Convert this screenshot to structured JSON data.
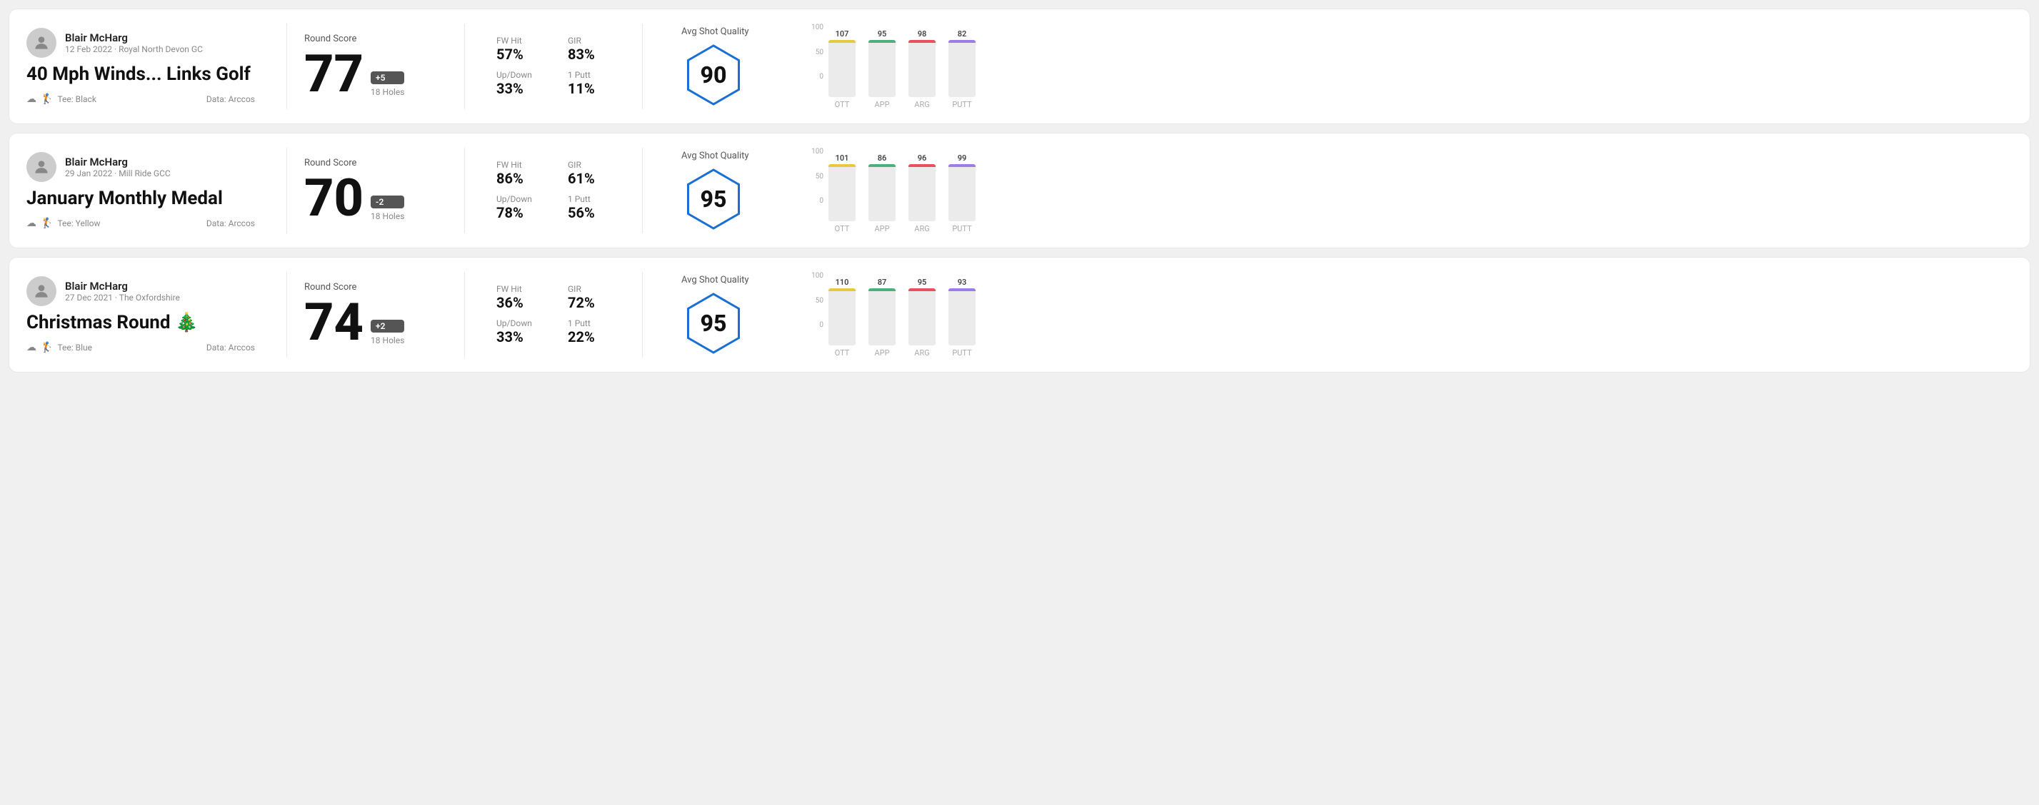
{
  "cards": [
    {
      "id": "card-1",
      "user": {
        "name": "Blair McHarg",
        "date": "12 Feb 2022 · Royal North Devon GC"
      },
      "title": "40 Mph Winds... Links Golf",
      "title_emoji": "🏌️",
      "tee": "Black",
      "data_source": "Data: Arccos",
      "score": {
        "label": "Round Score",
        "number": "77",
        "badge": "+5",
        "holes": "18 Holes"
      },
      "stats": {
        "fw_hit_label": "FW Hit",
        "fw_hit_value": "57%",
        "gir_label": "GIR",
        "gir_value": "83%",
        "updown_label": "Up/Down",
        "updown_value": "33%",
        "oneputt_label": "1 Putt",
        "oneputt_value": "11%"
      },
      "quality": {
        "label": "Avg Shot Quality",
        "value": "90"
      },
      "chart": {
        "bars": [
          {
            "label": "OTT",
            "value": 107,
            "color": "#e8c840",
            "height_pct": 75
          },
          {
            "label": "APP",
            "value": 95,
            "color": "#4caf7d",
            "height_pct": 65
          },
          {
            "label": "ARG",
            "value": 98,
            "color": "#e85060",
            "height_pct": 68
          },
          {
            "label": "PUTT",
            "value": 82,
            "color": "#9c7de8",
            "height_pct": 55
          }
        ],
        "y_labels": [
          "100",
          "50",
          "0"
        ]
      }
    },
    {
      "id": "card-2",
      "user": {
        "name": "Blair McHarg",
        "date": "29 Jan 2022 · Mill Ride GCC"
      },
      "title": "January Monthly Medal",
      "title_emoji": "",
      "tee": "Yellow",
      "data_source": "Data: Arccos",
      "score": {
        "label": "Round Score",
        "number": "70",
        "badge": "-2",
        "holes": "18 Holes"
      },
      "stats": {
        "fw_hit_label": "FW Hit",
        "fw_hit_value": "86%",
        "gir_label": "GIR",
        "gir_value": "61%",
        "updown_label": "Up/Down",
        "updown_value": "78%",
        "oneputt_label": "1 Putt",
        "oneputt_value": "56%"
      },
      "quality": {
        "label": "Avg Shot Quality",
        "value": "95"
      },
      "chart": {
        "bars": [
          {
            "label": "OTT",
            "value": 101,
            "color": "#e8c840",
            "height_pct": 72
          },
          {
            "label": "APP",
            "value": 86,
            "color": "#4caf7d",
            "height_pct": 60
          },
          {
            "label": "ARG",
            "value": 96,
            "color": "#e85060",
            "height_pct": 67
          },
          {
            "label": "PUTT",
            "value": 99,
            "color": "#9c7de8",
            "height_pct": 70
          }
        ],
        "y_labels": [
          "100",
          "50",
          "0"
        ]
      }
    },
    {
      "id": "card-3",
      "user": {
        "name": "Blair McHarg",
        "date": "27 Dec 2021 · The Oxfordshire"
      },
      "title": "Christmas Round 🎄",
      "title_emoji": "",
      "tee": "Blue",
      "data_source": "Data: Arccos",
      "score": {
        "label": "Round Score",
        "number": "74",
        "badge": "+2",
        "holes": "18 Holes"
      },
      "stats": {
        "fw_hit_label": "FW Hit",
        "fw_hit_value": "36%",
        "gir_label": "GIR",
        "gir_value": "72%",
        "updown_label": "Up/Down",
        "updown_value": "33%",
        "oneputt_label": "1 Putt",
        "oneputt_value": "22%"
      },
      "quality": {
        "label": "Avg Shot Quality",
        "value": "95"
      },
      "chart": {
        "bars": [
          {
            "label": "OTT",
            "value": 110,
            "color": "#e8c840",
            "height_pct": 78
          },
          {
            "label": "APP",
            "value": 87,
            "color": "#4caf7d",
            "height_pct": 61
          },
          {
            "label": "ARG",
            "value": 95,
            "color": "#e85060",
            "height_pct": 67
          },
          {
            "label": "PUTT",
            "value": 93,
            "color": "#9c7de8",
            "height_pct": 65
          }
        ],
        "y_labels": [
          "100",
          "50",
          "0"
        ]
      }
    }
  ]
}
